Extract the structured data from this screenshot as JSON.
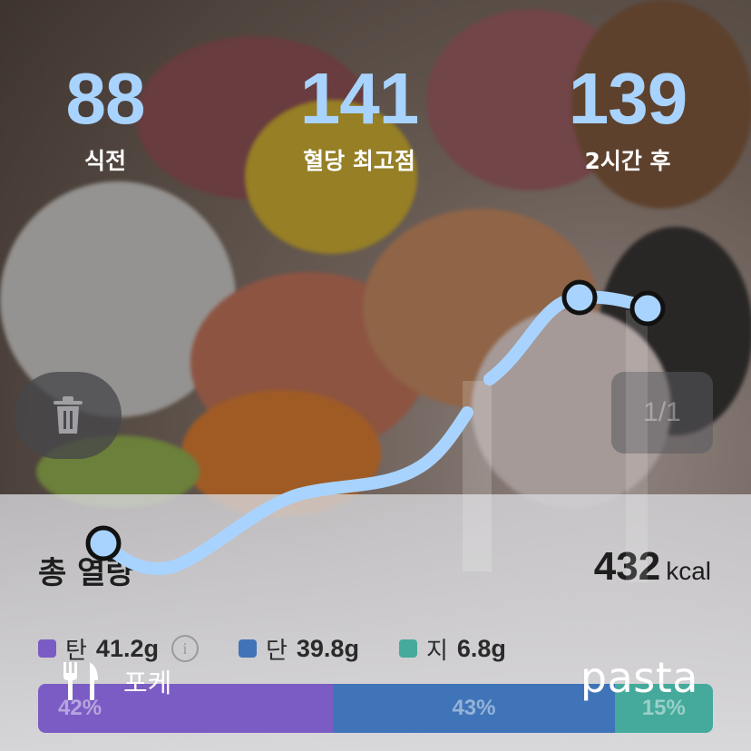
{
  "stats": [
    {
      "value": "88",
      "label": "식전"
    },
    {
      "value": "141",
      "label": "혈당 최고점"
    },
    {
      "value": "139",
      "label": "2시간 후"
    }
  ],
  "pager": "1/1",
  "nutrition": {
    "total_label": "총 열량",
    "kcal_value": "432",
    "kcal_unit": "kcal",
    "macros": [
      {
        "name": "탄",
        "grams": "41.2g",
        "color": "#7b5cc4",
        "percent": "42%",
        "share": 42,
        "info_icon": "info-icon"
      },
      {
        "name": "단",
        "grams": "39.8g",
        "color": "#3f74b8",
        "percent": "43%",
        "share": 43
      },
      {
        "name": "지",
        "grams": "6.8g",
        "color": "#45aa9c",
        "percent": "15%",
        "share": 15
      }
    ]
  },
  "glucose_points": [
    {
      "time": "식전",
      "value": 88
    },
    {
      "time": "peak",
      "value": 141
    },
    {
      "time": "2시간 후",
      "value": 139
    }
  ],
  "meal": {
    "icon": "fork-knife-icon",
    "name": "포케"
  },
  "brand": "pasta",
  "colors": {
    "accent": "#a9d3ff",
    "curve": "#a9d3ff"
  },
  "icons": {
    "trash": "trash-icon"
  }
}
